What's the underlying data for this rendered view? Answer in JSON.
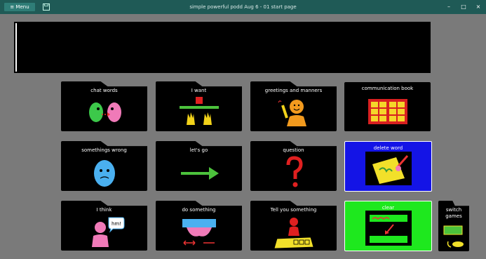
{
  "titlebar": {
    "menu_label": "≡ Menu",
    "title": "simple powerful podd Aug 6 - 01 start page",
    "minimize": "–",
    "maximize": "□",
    "close": "×"
  },
  "tiles": {
    "chat_words": "chat words",
    "i_want": "I want",
    "greetings": "greetings and manners",
    "comm_book": "communication book",
    "somethings_wrong": "somethings wrong",
    "lets_go": "let's go",
    "question": "question",
    "delete_word": "delete word",
    "i_think": "I think",
    "do_something": "do something",
    "tell_you": "Tell you something",
    "clear": "clear",
    "switch_games": "switch games"
  },
  "colors": {
    "titlebar": "#1f5a56",
    "background": "#7a7a7a",
    "delete_tile": "#1414e6",
    "clear_tile": "#1ee81e"
  }
}
